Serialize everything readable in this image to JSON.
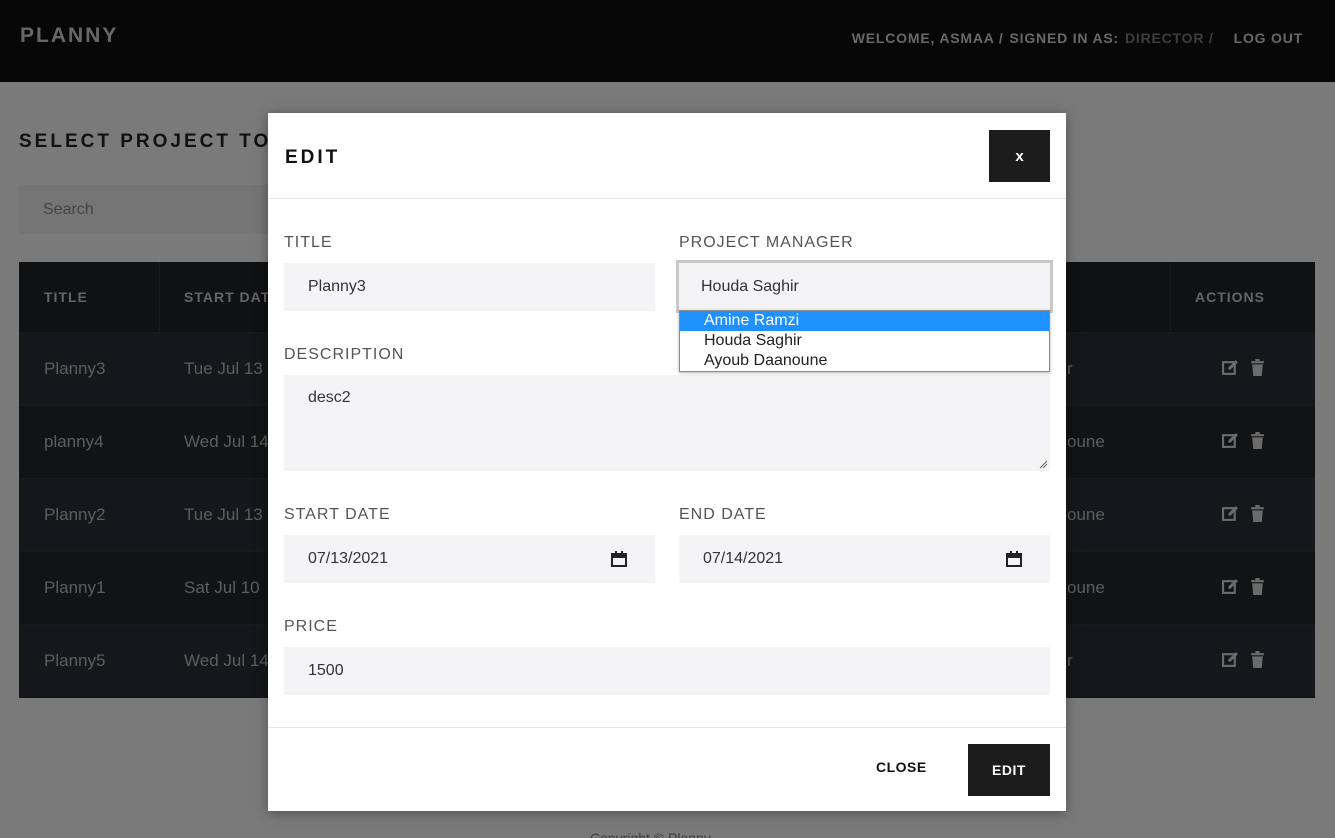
{
  "header": {
    "brand": "PLANNY",
    "welcome": "WELCOME, ASMAA /",
    "signed_in_label": "SIGNED IN AS:",
    "role": "DIRECTOR /",
    "logout": "LOG OUT"
  },
  "page": {
    "title": "SELECT PROJECT TO",
    "search_placeholder": "Search",
    "footer_partial": "Copyright © Planny"
  },
  "table": {
    "columns": [
      "TITLE",
      "START DATE",
      "ACTIONS"
    ],
    "rows": [
      {
        "title": "Planny3",
        "start": "Tue Jul 13",
        "manager_tail": "r"
      },
      {
        "title": "planny4",
        "start": "Wed Jul 14",
        "manager_tail": "oune"
      },
      {
        "title": "Planny2",
        "start": "Tue Jul 13",
        "manager_tail": "oune"
      },
      {
        "title": "Planny1",
        "start": "Sat Jul 10",
        "manager_tail": "oune"
      },
      {
        "title": "Planny5",
        "start": "Wed Jul 14",
        "manager_tail": "r"
      }
    ]
  },
  "modal": {
    "title": "EDIT",
    "close_x": "x",
    "title_label": "TITLE",
    "title_value": "Planny3",
    "manager_label": "PROJECT MANAGER",
    "manager_value": "Houda Saghir",
    "manager_options": [
      "Amine Ramzi",
      "Houda Saghir",
      "Ayoub Daanoune"
    ],
    "manager_highlighted": "Amine Ramzi",
    "description_label": "DESCRIPTION",
    "description_value": "desc2",
    "start_label": "START DATE",
    "start_value": "07/13/2021",
    "end_label": "END DATE",
    "end_value": "07/14/2021",
    "price_label": "PRICE",
    "price_value": "1500",
    "close_button": "CLOSE",
    "edit_button": "EDIT"
  }
}
